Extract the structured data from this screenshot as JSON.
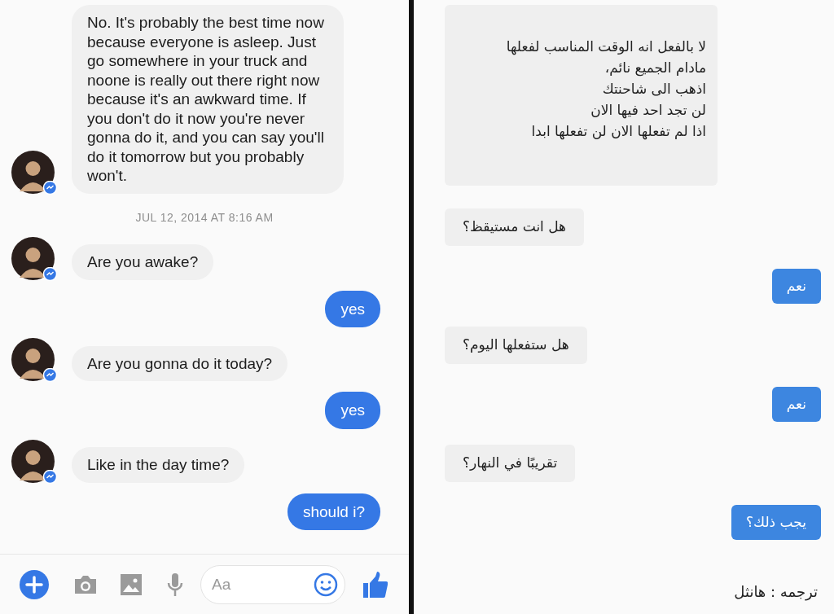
{
  "left": {
    "messages": [
      {
        "kind": "received",
        "text": "No. It's probably the best time now because everyone is asleep. Just go somewhere in your truck and noone is really out there right now because it's an awkward time. If you don't do it now you're never gonna do it, and you can say you'll do it tomorrow but you probably won't."
      },
      {
        "kind": "timestamp",
        "text": "JUL 12, 2014 AT 8:16 AM"
      },
      {
        "kind": "received",
        "text": "Are you awake?"
      },
      {
        "kind": "sent",
        "text": "yes"
      },
      {
        "kind": "received",
        "text": "Are you gonna do it today?"
      },
      {
        "kind": "sent",
        "text": "yes"
      },
      {
        "kind": "received",
        "text": "Like in the day time?"
      },
      {
        "kind": "sent",
        "text": "should i?"
      }
    ],
    "composer": {
      "placeholder": "Aa"
    }
  },
  "right": {
    "messages": [
      {
        "kind": "received",
        "text": "لا بالفعل انه الوقت المناسب لفعلها\nمادام الجميع نائم،\nاذهب الى شاحنتك\nلن تجد احد فيها الان\nاذا لم تفعلها الان لن تفعلها ابدا"
      },
      {
        "kind": "received",
        "text": "هل انت مستيقظ؟"
      },
      {
        "kind": "sent",
        "text": "نعم"
      },
      {
        "kind": "received",
        "text": "هل ستفعلها اليوم؟"
      },
      {
        "kind": "sent",
        "text": "نعم"
      },
      {
        "kind": "received",
        "text": "تقريبًا في النهار؟"
      },
      {
        "kind": "sent",
        "text": "يجب ذلك؟"
      }
    ],
    "credit": "ترجمه : هانثل"
  }
}
